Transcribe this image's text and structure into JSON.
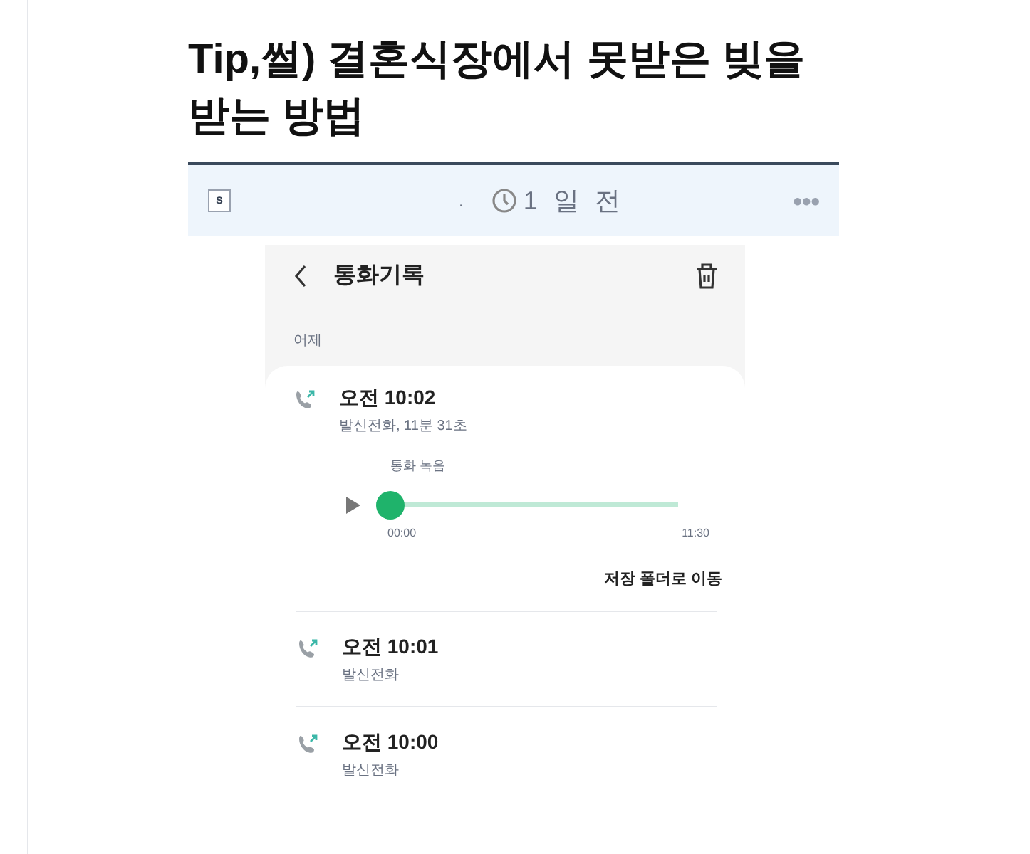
{
  "post": {
    "title": "Tip,썰) 결혼식장에서 못받은 빚을 받는 방법",
    "badge": "s",
    "separator": ".",
    "time": "1 일 전",
    "more": "●●●"
  },
  "screenshot": {
    "header": {
      "title": "통화기록"
    },
    "section": "어제",
    "calls": [
      {
        "time": "오전 10:02",
        "detail": "발신전화, 11분 31초",
        "recording": {
          "label": "통화 녹음",
          "level": 0,
          "start": "00:00",
          "end": "11:30",
          "action": "저장 폴더로 이동"
        }
      },
      {
        "time": "오전 10:01",
        "detail": "발신전화"
      },
      {
        "time": "오전 10:00",
        "detail": "발신전화"
      }
    ]
  }
}
